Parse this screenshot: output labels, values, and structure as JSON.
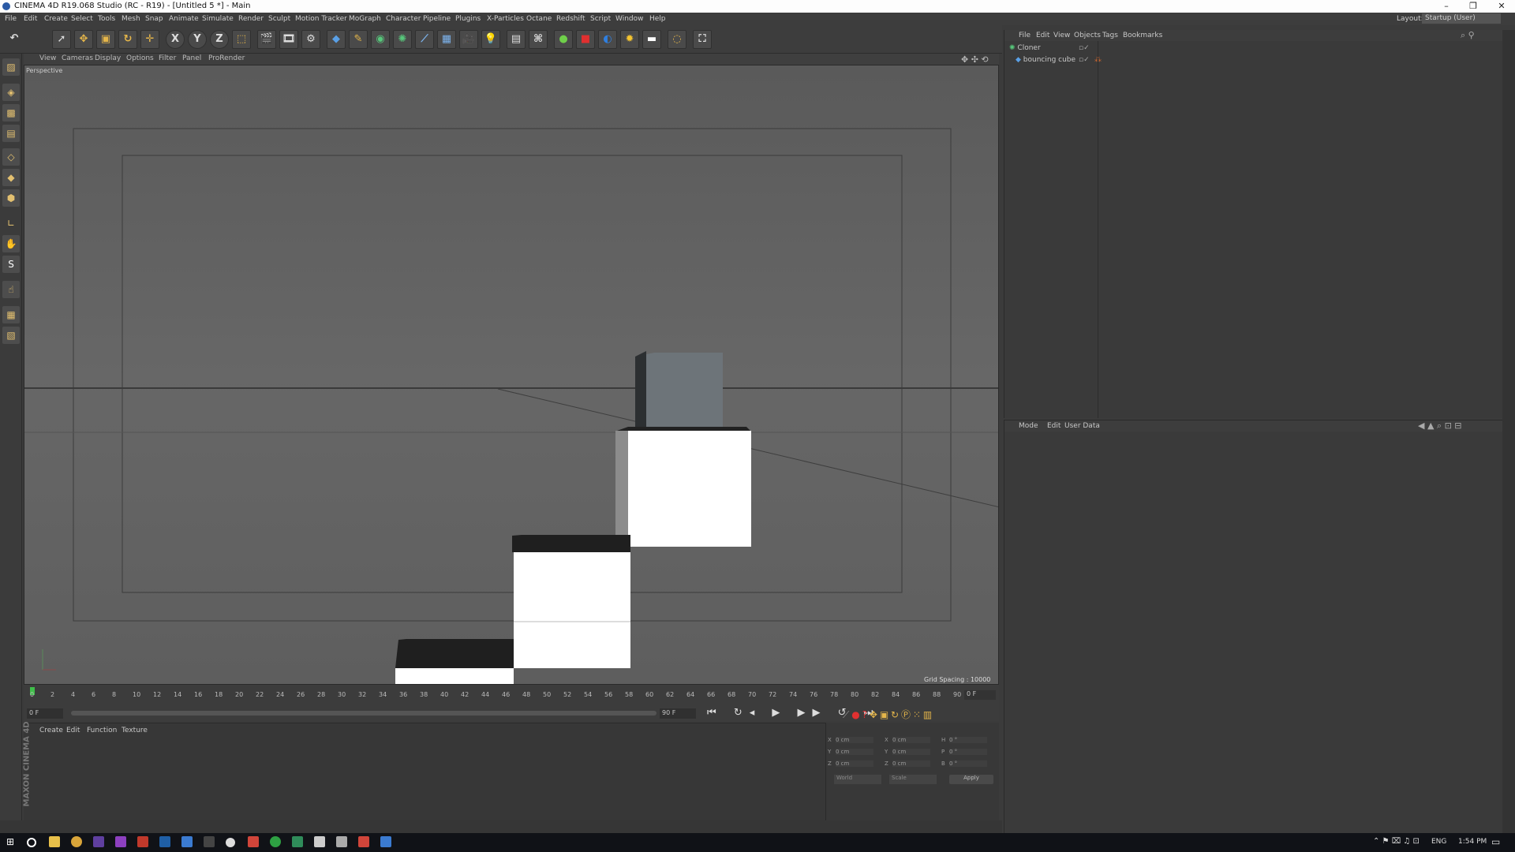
{
  "window": {
    "title": "CINEMA 4D R19.068 Studio (RC - R19) - [Untitled 5 *] - Main",
    "min": "–",
    "max": "❐",
    "close": "✕"
  },
  "menubar": {
    "items": [
      "File",
      "Edit",
      "Create",
      "Select",
      "Tools",
      "Mesh",
      "Snap",
      "Animate",
      "Simulate",
      "Render",
      "Sculpt",
      "Motion Tracker",
      "MoGraph",
      "Character",
      "Pipeline",
      "Plugins",
      "X-Particles",
      "Octane",
      "Redshift",
      "Script",
      "Window",
      "Help"
    ],
    "layout_label": "Layout:",
    "layout_value": "Startup (User)"
  },
  "toolbar": {
    "x": "X",
    "y": "Y",
    "z": "Z"
  },
  "viewport": {
    "menu": [
      "View",
      "Cameras",
      "Display",
      "Options",
      "Filter",
      "Panel",
      "ProRender"
    ],
    "label": "Perspective",
    "grid_spacing": "Grid Spacing : 10000 cm"
  },
  "timeline": {
    "ticks": [
      "0",
      "2",
      "4",
      "6",
      "8",
      "10",
      "12",
      "14",
      "16",
      "18",
      "20",
      "22",
      "24",
      "26",
      "28",
      "30",
      "32",
      "34",
      "36",
      "38",
      "40",
      "42",
      "44",
      "46",
      "48",
      "50",
      "52",
      "54",
      "56",
      "58",
      "60",
      "62",
      "64",
      "66",
      "68",
      "70",
      "72",
      "74",
      "76",
      "78",
      "80",
      "82",
      "84",
      "86",
      "88",
      "90"
    ],
    "end_frame": "0 F",
    "start_field": "0 F",
    "end_field": "90 F"
  },
  "material": {
    "menu": [
      "Create",
      "Edit",
      "Function",
      "Texture"
    ]
  },
  "coords": {
    "rows": [
      [
        "X",
        "0 cm",
        "X",
        "0 cm",
        "H",
        "0 °"
      ],
      [
        "Y",
        "0 cm",
        "Y",
        "0 cm",
        "P",
        "0 °"
      ],
      [
        "Z",
        "0 cm",
        "Z",
        "0 cm",
        "B",
        "0 °"
      ]
    ],
    "dd1": "World",
    "dd2": "Scale",
    "apply": "Apply"
  },
  "objects": {
    "menu": [
      "File",
      "Edit",
      "View",
      "Objects",
      "Tags",
      "Bookmarks"
    ],
    "items": [
      {
        "name": "Cloner"
      },
      {
        "name": "bouncing cube"
      }
    ]
  },
  "attributes": {
    "menu": [
      "Mode",
      "Edit",
      "User Data"
    ]
  },
  "brand": "MAXON CINEMA 4D",
  "taskbar": {
    "lang": "ENG",
    "time": "1:54 PM"
  },
  "colors": {
    "accent": "#3b7bd1",
    "viewport": "#616161",
    "cube_face": "#ffffff"
  }
}
